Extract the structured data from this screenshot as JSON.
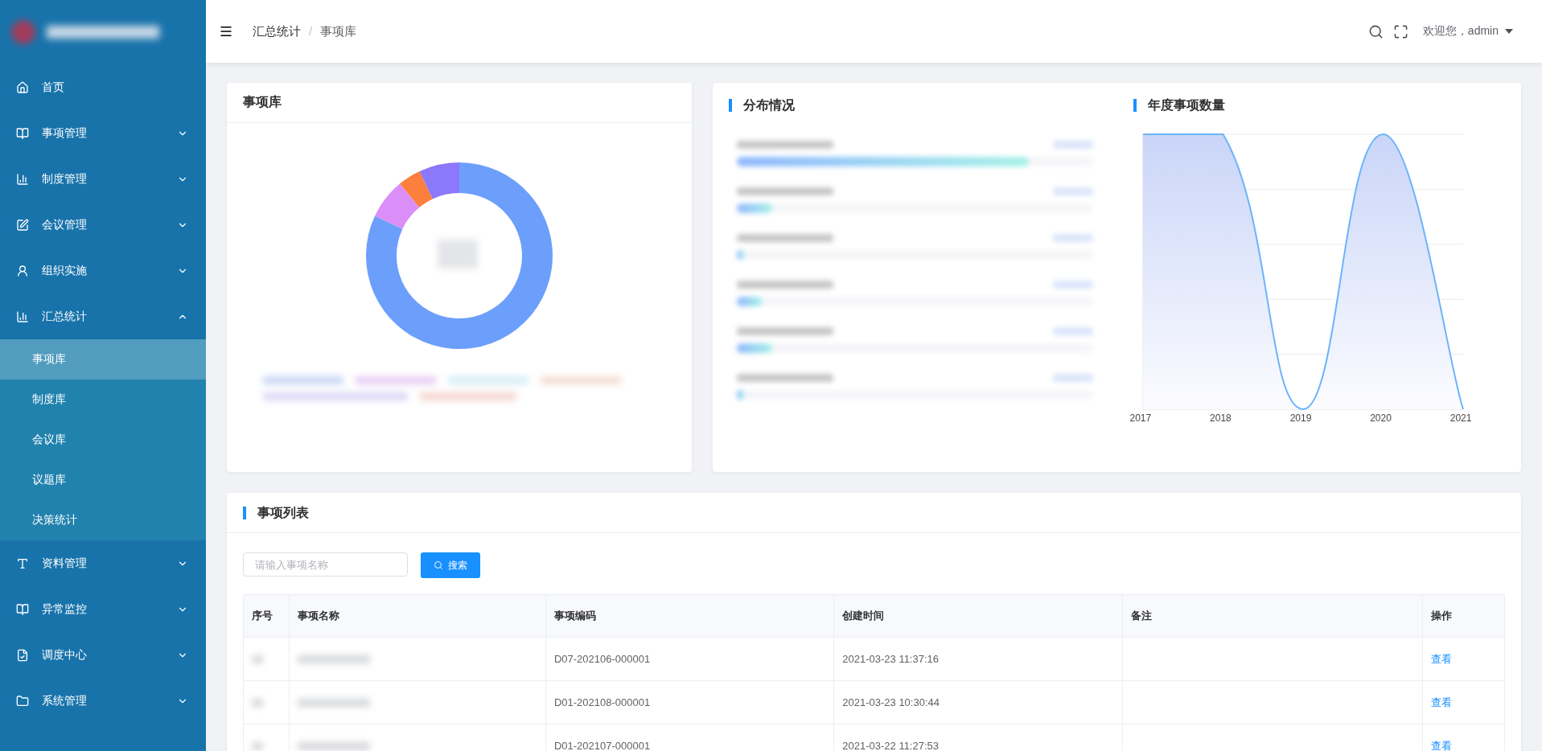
{
  "sidebar": {
    "items": [
      {
        "label": "首页",
        "kind": "link"
      },
      {
        "label": "事项管理",
        "kind": "group",
        "expanded": false
      },
      {
        "label": "制度管理",
        "kind": "group",
        "expanded": false
      },
      {
        "label": "会议管理",
        "kind": "group",
        "expanded": false
      },
      {
        "label": "组织实施",
        "kind": "group",
        "expanded": false
      },
      {
        "label": "汇总统计",
        "kind": "group",
        "expanded": true,
        "children": [
          {
            "label": "事项库",
            "selected": true
          },
          {
            "label": "制度库",
            "selected": false
          },
          {
            "label": "会议库",
            "selected": false
          },
          {
            "label": "议题库",
            "selected": false
          },
          {
            "label": "决策统计",
            "selected": false
          }
        ]
      },
      {
        "label": "资料管理",
        "kind": "group",
        "expanded": false
      },
      {
        "label": "异常监控",
        "kind": "group",
        "expanded": false
      },
      {
        "label": "调度中心",
        "kind": "group",
        "expanded": false
      },
      {
        "label": "系统管理",
        "kind": "group",
        "expanded": false
      }
    ]
  },
  "header": {
    "breadcrumb": [
      "汇总统计",
      "事项库"
    ],
    "separator": "/",
    "user": "欢迎您，admin"
  },
  "library_card": {
    "title": "事项库"
  },
  "distribution": {
    "title": "分布情况",
    "bars": [
      {
        "level": 0.82
      },
      {
        "level": 0.1
      },
      {
        "level": 0.02
      },
      {
        "level": 0.07
      },
      {
        "level": 0.1
      },
      {
        "level": 0.02
      }
    ]
  },
  "yearly": {
    "title": "年度事项数量",
    "x_labels": [
      "2017",
      "2018",
      "2019",
      "2020",
      "2021"
    ]
  },
  "list": {
    "title": "事项列表",
    "search": {
      "placeholder": "请输入事项名称"
    },
    "search_button": "搜索",
    "columns": [
      "序号",
      "事项名称",
      "事项编码",
      "创建时间",
      "备注",
      "操作"
    ],
    "rows": [
      {
        "code": "D07-202106-000001",
        "created": "2021-03-23 11:37:16",
        "action": "查看"
      },
      {
        "code": "D01-202108-000001",
        "created": "2021-03-23 10:30:44",
        "action": "查看"
      },
      {
        "code": "D01-202107-000001",
        "created": "2021-03-22 11:27:53",
        "action": "查看"
      }
    ]
  }
}
